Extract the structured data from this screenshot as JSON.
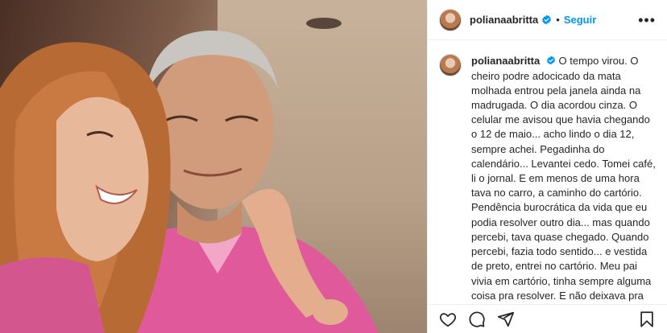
{
  "post": {
    "username": "polianaabritta",
    "follow_label": "Seguir",
    "separator": "•",
    "more_label": "•••",
    "caption": "O tempo virou. O cheiro podre adocicado da mata molhada entrou pela janela ainda na madrugada. O dia acordou cinza. O celular me avisou que havia chegando o 12 de maio... acho lindo o dia 12, sempre achei. Pegadinha do calendário... Levantei cedo. Tomei café, li o jornal. E em menos de uma hora tava no carro, a caminho do cartório. Pendência burocrática da vida que eu podia resolver outro dia... mas quando percebi, tava quase chegado. Quando percebi, fazia todo sentido... e vestida de preto, entrei no cartório. Meu pai vivia em cartório, tinha sempre alguma coisa pra resolver. E não deixava pra depois, nada, nun-ca ficava pra depois. Só tentou procrastinar com a morte, mas aí foi a"
  },
  "icons": {
    "verified": "verified-badge-icon",
    "like": "heart-icon",
    "comment": "comment-icon",
    "share": "share-icon",
    "save": "bookmark-icon"
  },
  "colors": {
    "accent": "#0095f6",
    "text": "#262626",
    "shirt": "#e0599b"
  }
}
